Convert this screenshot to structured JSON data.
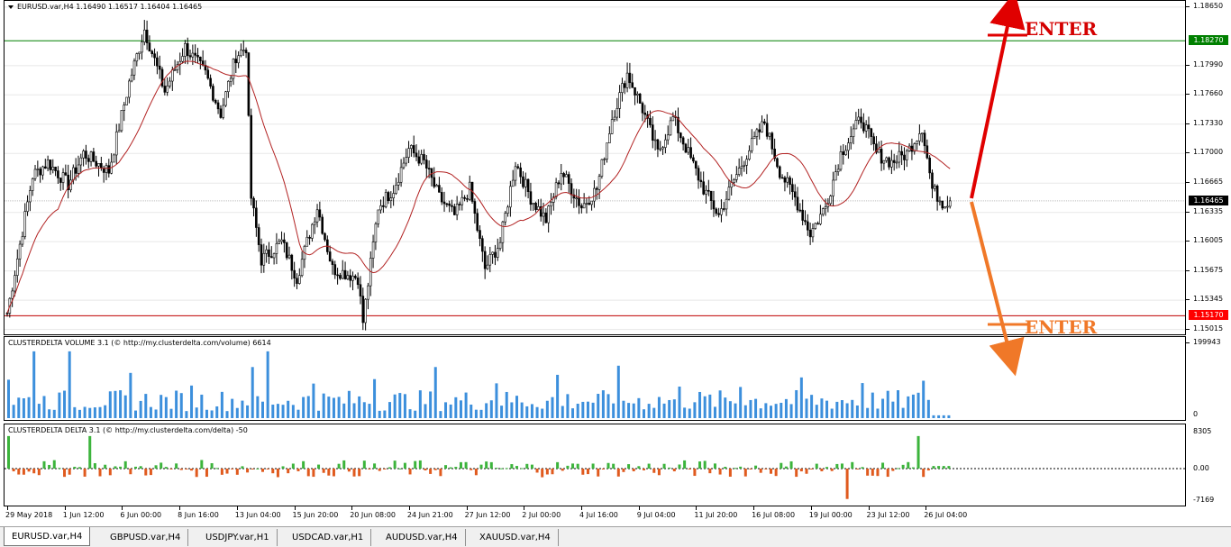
{
  "window": {
    "symbol_header": "EURUSD.var,H4  1.16490 1.16517 1.16404 1.16465"
  },
  "price_axis": {
    "ticks": [
      "1.18650",
      "1.18270",
      "1.17990",
      "1.17660",
      "1.17330",
      "1.17000",
      "1.16665",
      "1.16465",
      "1.16335",
      "1.16005",
      "1.15675",
      "1.15345",
      "1.15170",
      "1.15015"
    ],
    "plain_ticks": [
      {
        "label": "1.18650",
        "value": 1.1865
      },
      {
        "label": "1.17990",
        "value": 1.1799
      },
      {
        "label": "1.17660",
        "value": 1.1766
      },
      {
        "label": "1.17330",
        "value": 1.1733
      },
      {
        "label": "1.17000",
        "value": 1.17
      },
      {
        "label": "1.16665",
        "value": 1.16665
      },
      {
        "label": "1.16335",
        "value": 1.16335
      },
      {
        "label": "1.16005",
        "value": 1.16005
      },
      {
        "label": "1.15675",
        "value": 1.15675
      },
      {
        "label": "1.15345",
        "value": 1.15345
      },
      {
        "label": "1.15015",
        "value": 1.15015
      }
    ],
    "badges": [
      {
        "label": "1.18270",
        "value": 1.1827,
        "color": "#008000"
      },
      {
        "label": "1.16465",
        "value": 1.16465,
        "color": "#000000"
      },
      {
        "label": "1.15170",
        "value": 1.1517,
        "color": "#ff0000"
      }
    ]
  },
  "levels": {
    "resistance": 1.1827,
    "support": 1.1517,
    "current": 1.16465,
    "resistance_color": "#008000",
    "support_color": "#c00000",
    "ma_color": "#b22222"
  },
  "volume_indicator": {
    "title": "CLUSTERDELTA VOLUME 3.1 (© http://my.clusterdelta.com/volume) 6614",
    "axis_top": "199943",
    "axis_bottom": "0",
    "color": "#3c8fdc"
  },
  "delta_indicator": {
    "title": "CLUSTERDELTA DELTA 3.1 (© http://my.clusterdelta.com/delta) -50",
    "axis_top": "8305",
    "axis_mid": "0.00",
    "axis_bottom": "-7169",
    "pos_color": "#3cb43c",
    "neg_color": "#e05a1e"
  },
  "time_axis": [
    "29 May 2018",
    "1 Jun 12:00",
    "6 Jun 00:00",
    "8 Jun 16:00",
    "13 Jun 04:00",
    "15 Jun 20:00",
    "20 Jun 08:00",
    "24 Jun 21:00",
    "27 Jun 12:00",
    "2 Jul 00:00",
    "4 Jul 16:00",
    "9 Jul 04:00",
    "11 Jul 20:00",
    "16 Jul 08:00",
    "19 Jul 00:00",
    "23 Jul 12:00",
    "26 Jul 04:00"
  ],
  "annotations": {
    "enter_top": "ENTER",
    "enter_bottom": "ENTER",
    "up_color": "#e00000",
    "down_color": "#f07828"
  },
  "tabs": [
    "EURUSD.var,H4",
    "GBPUSD.var,H4",
    "USDJPY.var,H1",
    "USDCAD.var,H1",
    "AUDUSD.var,H4",
    "XAUUSD.var,H4"
  ],
  "chart_data": {
    "type": "candlestick",
    "symbol": "EURUSD.var",
    "timeframe": "H4",
    "last_bar": {
      "open": 1.1649,
      "high": 1.16517,
      "low": 1.16404,
      "close": 1.16465
    },
    "ylim": [
      1.1496,
      1.1872
    ],
    "start_price": 1.152,
    "end_price": 1.16465,
    "path": [
      [
        0,
        1.152
      ],
      [
        10,
        1.1675
      ],
      [
        16,
        1.169
      ],
      [
        24,
        1.1665
      ],
      [
        30,
        1.17
      ],
      [
        40,
        1.168
      ],
      [
        48,
        1.178
      ],
      [
        54,
        1.184
      ],
      [
        62,
        1.177
      ],
      [
        70,
        1.182
      ],
      [
        78,
        1.179
      ],
      [
        84,
        1.1745
      ],
      [
        90,
        1.181
      ],
      [
        94,
        1.182
      ],
      [
        96,
        1.165
      ],
      [
        100,
        1.158
      ],
      [
        108,
        1.16
      ],
      [
        114,
        1.156
      ],
      [
        122,
        1.164
      ],
      [
        128,
        1.157
      ],
      [
        138,
        1.156
      ],
      [
        140,
        1.151
      ],
      [
        146,
        1.164
      ],
      [
        152,
        1.166
      ],
      [
        158,
        1.1705
      ],
      [
        164,
        1.169
      ],
      [
        170,
        1.165
      ],
      [
        176,
        1.163
      ],
      [
        182,
        1.166
      ],
      [
        188,
        1.157
      ],
      [
        194,
        1.16
      ],
      [
        200,
        1.169
      ],
      [
        206,
        1.165
      ],
      [
        212,
        1.1625
      ],
      [
        218,
        1.168
      ],
      [
        226,
        1.164
      ],
      [
        232,
        1.166
      ],
      [
        238,
        1.174
      ],
      [
        244,
        1.179
      ],
      [
        250,
        1.175
      ],
      [
        256,
        1.17
      ],
      [
        262,
        1.174
      ],
      [
        268,
        1.17
      ],
      [
        274,
        1.166
      ],
      [
        280,
        1.163
      ],
      [
        286,
        1.167
      ],
      [
        292,
        1.1705
      ],
      [
        298,
        1.1735
      ],
      [
        304,
        1.168
      ],
      [
        310,
        1.165
      ],
      [
        316,
        1.161
      ],
      [
        322,
        1.164
      ],
      [
        328,
        1.17
      ],
      [
        336,
        1.174
      ],
      [
        342,
        1.17
      ],
      [
        348,
        1.169
      ],
      [
        354,
        1.17
      ],
      [
        360,
        1.173
      ],
      [
        364,
        1.166
      ],
      [
        368,
        1.1645
      ],
      [
        371,
        1.16465
      ]
    ],
    "volume_range": [
      0,
      199943
    ],
    "delta_range": [
      -7169,
      8305
    ],
    "annotations": [
      {
        "label": "ENTER",
        "direction": "up",
        "level": 1.1827
      },
      {
        "label": "ENTER",
        "direction": "down",
        "level": 1.1517
      }
    ]
  }
}
